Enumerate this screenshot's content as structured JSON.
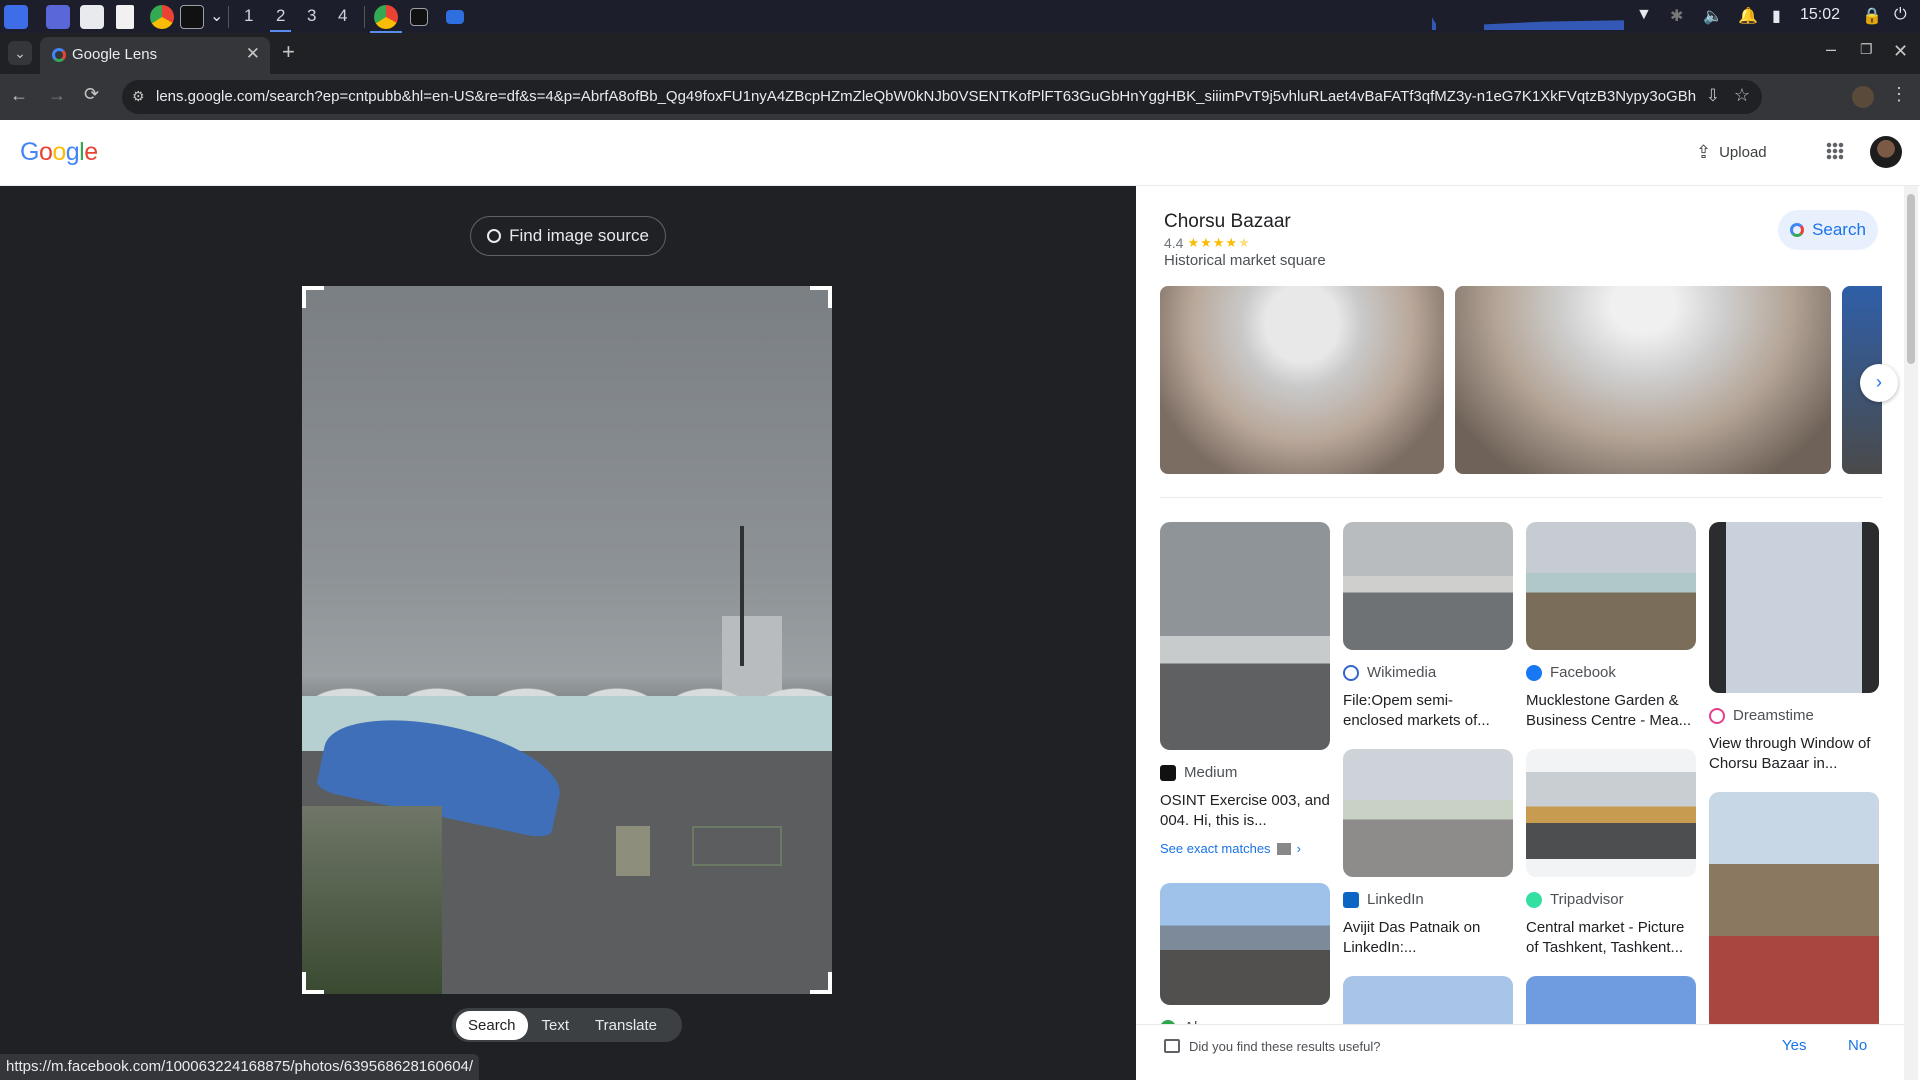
{
  "taskbar": {
    "workspaces": [
      "1",
      "2",
      "3",
      "4"
    ],
    "active_workspace": "2",
    "clock": "15:02"
  },
  "browser": {
    "tab_title": "Google Lens",
    "url": "lens.google.com/search?ep=cntpubb&hl=en-US&re=df&s=4&p=AbrfA8ofBb_Qg49foxFU1nyA4ZBcpHZmZleQbW0kNJb0VSENTKofPlFT63GuGbHnYggHBK_siiimPvT9j5vhluRLaet4vBaFATf3qfMZ3y-n1eG7K1XkFVqtzB3Nypy3oGBhF_gbA3cyBiUaYeZbd8x_nl..."
  },
  "header": {
    "logo": "Google",
    "upload_label": "Upload"
  },
  "left": {
    "find_source": "Find image source",
    "modes": [
      "Search",
      "Text",
      "Translate"
    ],
    "active_mode": "Search"
  },
  "place": {
    "name": "Chorsu Bazaar",
    "rating": "4.4",
    "stars": 4.4,
    "category": "Historical market square",
    "search_label": "Search"
  },
  "results": [
    {
      "source": "Medium",
      "title": "OSINT Exercise 003, and 004. Hi, this is...",
      "extra": "See exact matches"
    },
    {
      "source": "Alamy",
      "title": ""
    },
    {
      "source": "Wikimedia",
      "title": "File:Opem semi-enclosed markets of..."
    },
    {
      "source": "LinkedIn",
      "title": "Avijit Das Patnaik on LinkedIn:..."
    },
    {
      "source": "Facebook",
      "title": "Mucklestone Garden & Business Centre - Mea..."
    },
    {
      "source": "Tripadvisor",
      "title": "Central market - Picture of Tashkent, Tashkent..."
    },
    {
      "source": "Dreamstime",
      "title": "View through Window of Chorsu Bazaar in..."
    }
  ],
  "feedback": {
    "question": "Did you find these results useful?",
    "yes": "Yes",
    "no": "No"
  },
  "status_bar_url": "https://m.facebook.com/100063224168875/photos/639568628160604/",
  "colors": {
    "accent_blue": "#1a73e8",
    "star": "#fbbc04",
    "dark_panel": "#202124"
  }
}
